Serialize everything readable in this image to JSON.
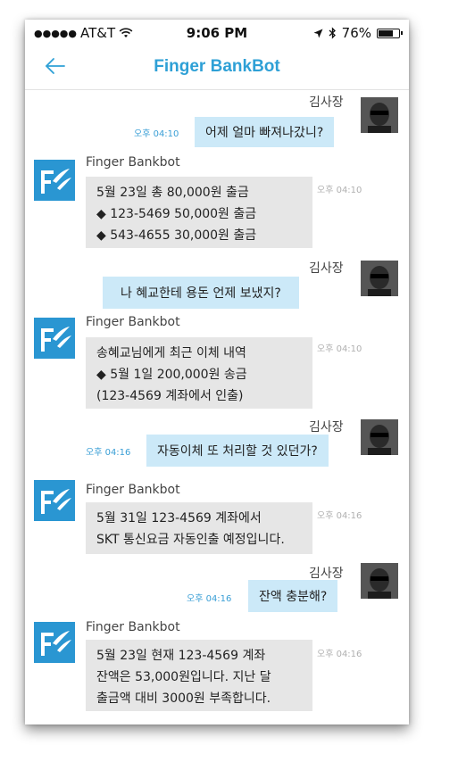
{
  "status_bar": {
    "carrier": "AT&T",
    "time": "9:06 PM",
    "battery": "76%",
    "battery_level": 0.76
  },
  "header": {
    "title": "Finger BankBot"
  },
  "colors": {
    "accent": "#2ea0d6",
    "user_bubble": "#cce9f8",
    "bot_bubble": "#e6e6e6",
    "bot_logo": "#2a96d2"
  },
  "messages": [
    {
      "user_name": "김사장",
      "user_time": "오후 04:10",
      "user_text": "어제 얼마 빠져나갔니?",
      "bot_name": "Finger Bankbot",
      "bot_time": "오후 04:10",
      "bot_lines": [
        "5월 23일 총 80,000원 출금",
        "◆ 123-5469  50,000원 출금",
        "◆ 543-4655  30,000원  출금"
      ]
    },
    {
      "user_name": "김사장",
      "user_time": "",
      "user_text": "나 혜교한테 용돈 언제 보냈지?",
      "bot_name": "Finger Bankbot",
      "bot_time": "오후 04:10",
      "bot_lines": [
        "송혜교님에게 최근 이체 내역",
        "◆ 5월 1일 200,000원 송금",
        "(123-4569 계좌에서 인출)"
      ]
    },
    {
      "user_name": "김사장",
      "user_time": "오후 04:16",
      "user_text": "자동이체 또 처리할 것 있던가?",
      "bot_name": "Finger Bankbot",
      "bot_time": "오후 04:16",
      "bot_lines": [
        "5월 31일 123-4569 계좌에서",
        "SKT 통신요금 자동인출 예정입니다."
      ]
    },
    {
      "user_name": "김사장",
      "user_time": "오후 04:16",
      "user_text": "잔액 충분해?",
      "bot_name": "Finger Bankbot",
      "bot_time": "오후 04:16",
      "bot_lines": [
        "5월 23일 현재 123-4569 계좌",
        "잔액은 53,000원입니다. 지난 달",
        "출금액 대비 3000원 부족합니다."
      ]
    }
  ]
}
